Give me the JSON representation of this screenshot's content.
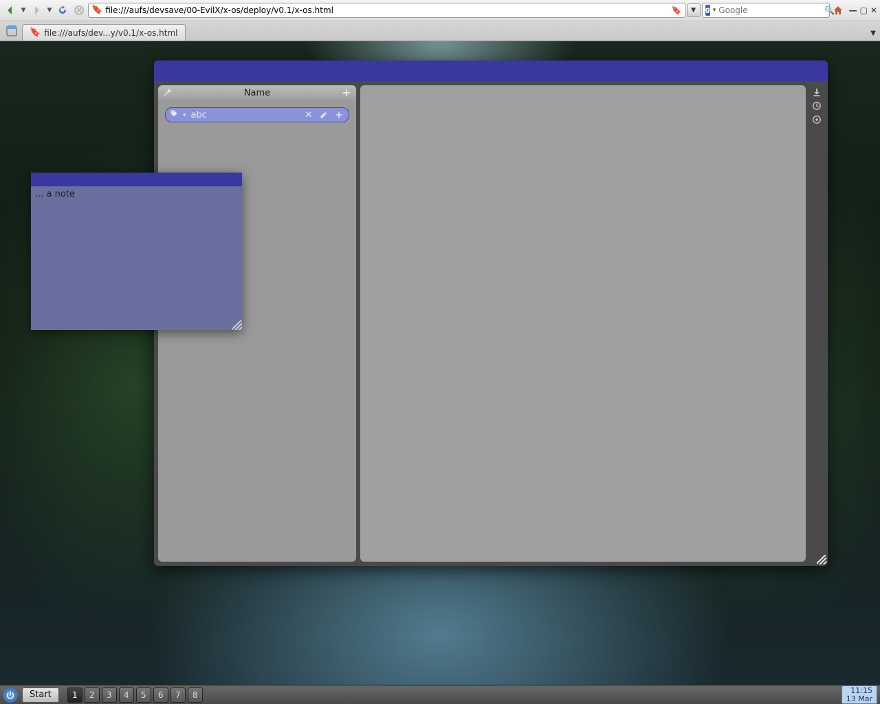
{
  "browser": {
    "url": "file:///aufs/devsave/00-EvilX/x-os/deploy/v0.1/x-os.html",
    "search_placeholder": "Google",
    "tab_label": "file:///aufs/dev...y/v0.1/x-os.html"
  },
  "app": {
    "left_panel": {
      "header_title": "Name",
      "items": [
        {
          "label": "abc"
        }
      ]
    }
  },
  "note": {
    "text": "... a note"
  },
  "taskbar": {
    "start_label": "Start",
    "workspaces": [
      "1",
      "2",
      "3",
      "4",
      "5",
      "6",
      "7",
      "8"
    ],
    "active_workspace": 0,
    "clock_time": "11:15",
    "clock_date": "13 Mar"
  }
}
